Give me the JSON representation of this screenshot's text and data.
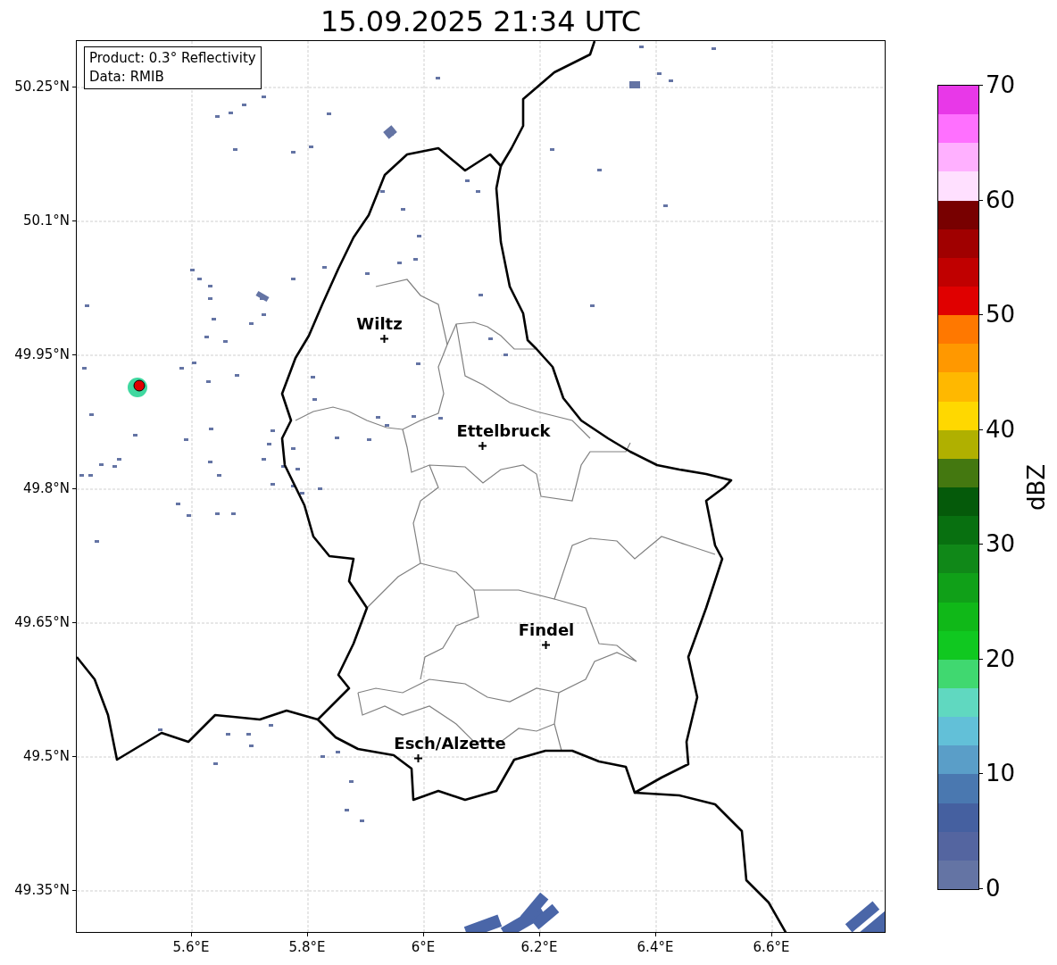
{
  "title": "15.09.2025 21:34 UTC",
  "info_box": {
    "lines": [
      "Product: 0.3° Reflectivity",
      "Data: RMIB"
    ]
  },
  "map": {
    "lat_ticks": [
      "50.25°N",
      "50.1°N",
      "49.95°N",
      "49.8°N",
      "49.65°N",
      "49.5°N",
      "49.35°N"
    ],
    "lon_ticks": [
      "5.6°E",
      "5.8°E",
      "6°E",
      "6.2°E",
      "6.4°E",
      "6.6°E"
    ],
    "cities": [
      {
        "name": "Wiltz"
      },
      {
        "name": "Ettelbruck"
      },
      {
        "name": "Findel"
      },
      {
        "name": "Esch/Alzette"
      }
    ]
  },
  "colorbar": {
    "label": "dBZ",
    "ticks": [
      "70",
      "60",
      "50",
      "40",
      "30",
      "20",
      "10",
      "0"
    ],
    "bins": [
      {
        "color": "#6474a4"
      },
      {
        "color": "#5465a0"
      },
      {
        "color": "#4560a0"
      },
      {
        "color": "#4a78b0"
      },
      {
        "color": "#5a9ec8"
      },
      {
        "color": "#62c0d8"
      },
      {
        "color": "#60d8c0"
      },
      {
        "color": "#40d870"
      },
      {
        "color": "#10c820"
      },
      {
        "color": "#10b818"
      },
      {
        "color": "#10a018"
      },
      {
        "color": "#108818"
      },
      {
        "color": "#087010"
      },
      {
        "color": "#055a0a"
      },
      {
        "color": "#447810"
      },
      {
        "color": "#b0b000"
      },
      {
        "color": "#ffd800"
      },
      {
        "color": "#ffb800"
      },
      {
        "color": "#ff9800"
      },
      {
        "color": "#ff7800"
      },
      {
        "color": "#e00000"
      },
      {
        "color": "#c00000"
      },
      {
        "color": "#a00000"
      },
      {
        "color": "#780000"
      },
      {
        "color": "#ffe0ff"
      },
      {
        "color": "#ffb0ff"
      },
      {
        "color": "#ff70ff"
      },
      {
        "color": "#e838e8"
      }
    ]
  }
}
